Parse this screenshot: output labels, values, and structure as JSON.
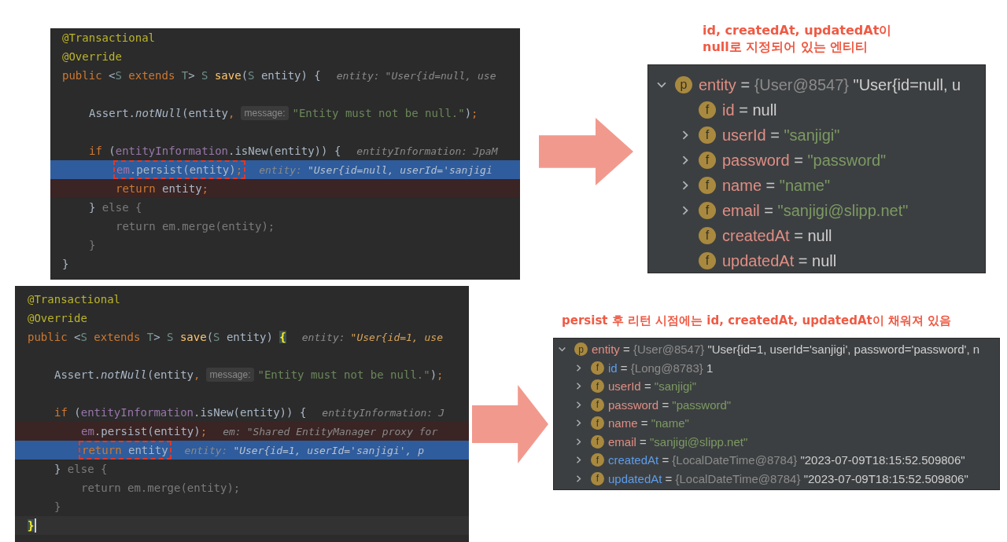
{
  "code_panels": [
    {
      "lines": [
        {
          "kind": "code",
          "segments": [
            {
              "kind": "code",
              "tokens": [
                {
                  "kind": "annotation",
                  "text": "@Transactional"
                }
              ]
            }
          ]
        },
        {
          "kind": "code",
          "segments": [
            {
              "kind": "code",
              "tokens": [
                {
                  "kind": "annotation",
                  "text": "@Override"
                }
              ]
            }
          ]
        },
        {
          "kind": "code",
          "segments": [
            {
              "kind": "code",
              "tokens": [
                {
                  "kind": "keyword",
                  "text": "public"
                },
                {
                  "kind": "plain",
                  "text": " <"
                },
                {
                  "kind": "type",
                  "text": "S"
                },
                {
                  "kind": "keyword",
                  "text": " extends "
                },
                {
                  "kind": "type",
                  "text": "T"
                },
                {
                  "kind": "plain",
                  "text": "> "
                },
                {
                  "kind": "type",
                  "text": "S"
                },
                {
                  "kind": "method",
                  "text": " save"
                },
                {
                  "kind": "plain",
                  "text": "("
                },
                {
                  "kind": "type",
                  "text": "S"
                },
                {
                  "kind": "plain",
                  "text": " entity) {"
                }
              ]
            },
            {
              "kind": "debug_hint",
              "label": "entity:",
              "value": "\"User{id=null, use",
              "changed": false
            }
          ],
          "children": [
            {
              "kind": "blank"
            },
            {
              "kind": "code",
              "segments": [
                {
                  "kind": "code",
                  "tokens": [
                    {
                      "kind": "plain",
                      "text": "Assert."
                    },
                    {
                      "kind": "italic",
                      "text": "notNull"
                    },
                    {
                      "kind": "plain",
                      "text": "(entity"
                    },
                    {
                      "kind": "keyword",
                      "text": ","
                    }
                  ]
                },
                {
                  "kind": "param_hint",
                  "text": "message:"
                },
                {
                  "kind": "code",
                  "tokens": [
                    {
                      "kind": "string",
                      "text": "\"Entity must not be null.\""
                    },
                    {
                      "kind": "plain",
                      "text": ")"
                    },
                    {
                      "kind": "keyword",
                      "text": ";"
                    }
                  ]
                }
              ]
            },
            {
              "kind": "blank"
            },
            {
              "kind": "code",
              "segments": [
                {
                  "kind": "code",
                  "tokens": [
                    {
                      "kind": "keyword",
                      "text": "if"
                    },
                    {
                      "kind": "plain",
                      "text": " ("
                    },
                    {
                      "kind": "field",
                      "text": "entityInformation"
                    },
                    {
                      "kind": "plain",
                      "text": ".isNew(entity)) {"
                    }
                  ]
                },
                {
                  "kind": "debug_hint",
                  "label": "entityInformation:",
                  "value": "JpaM",
                  "changed": false
                }
              ],
              "children": [
                {
                  "kind": "current",
                  "segments": [
                    {
                      "kind": "code",
                      "boxed": true,
                      "tokens": [
                        {
                          "kind": "field",
                          "text": "em"
                        },
                        {
                          "kind": "plain",
                          "text": ".persist(entity)"
                        },
                        {
                          "kind": "keyword",
                          "text": ";"
                        }
                      ]
                    },
                    {
                      "kind": "debug_hint",
                      "label": "entity:",
                      "value": "\"User{id=null, userId='sanjigi",
                      "changed": false
                    }
                  ]
                },
                {
                  "kind": "breakpoint",
                  "segments": [
                    {
                      "kind": "code",
                      "boxed": false,
                      "tokens": [
                        {
                          "kind": "keyword",
                          "text": "return"
                        },
                        {
                          "kind": "plain",
                          "text": " entity"
                        },
                        {
                          "kind": "keyword",
                          "text": ";"
                        }
                      ]
                    }
                  ]
                }
              ]
            },
            {
              "kind": "code",
              "segments": [
                {
                  "kind": "code",
                  "tokens": [
                    {
                      "kind": "plain",
                      "text": "}"
                    },
                    {
                      "kind": "dim",
                      "text": " else {"
                    }
                  ]
                }
              ],
              "children": [
                {
                  "kind": "code",
                  "segments": [
                    {
                      "kind": "code",
                      "tokens": [
                        {
                          "kind": "dim",
                          "text": "return em.merge(entity);"
                        }
                      ]
                    }
                  ]
                }
              ]
            },
            {
              "kind": "code",
              "segments": [
                {
                  "kind": "code",
                  "tokens": [
                    {
                      "kind": "dim",
                      "text": "}"
                    }
                  ]
                }
              ]
            }
          ]
        },
        {
          "kind": "code",
          "segments": [
            {
              "kind": "code",
              "tokens": [
                {
                  "kind": "plain",
                  "text": "}"
                }
              ]
            }
          ]
        }
      ]
    },
    {
      "lines": [
        {
          "kind": "code",
          "segments": [
            {
              "kind": "code",
              "tokens": [
                {
                  "kind": "annotation",
                  "text": "@Transactional"
                }
              ]
            }
          ]
        },
        {
          "kind": "code",
          "segments": [
            {
              "kind": "code",
              "tokens": [
                {
                  "kind": "annotation",
                  "text": "@Override"
                }
              ]
            }
          ]
        },
        {
          "kind": "code",
          "segments": [
            {
              "kind": "code",
              "tokens": [
                {
                  "kind": "keyword",
                  "text": "public"
                },
                {
                  "kind": "plain",
                  "text": " <"
                },
                {
                  "kind": "type",
                  "text": "S"
                },
                {
                  "kind": "keyword",
                  "text": " extends "
                },
                {
                  "kind": "type",
                  "text": "T"
                },
                {
                  "kind": "plain",
                  "text": "> "
                },
                {
                  "kind": "type",
                  "text": "S"
                },
                {
                  "kind": "method",
                  "text": " save"
                },
                {
                  "kind": "plain",
                  "text": "("
                },
                {
                  "kind": "type",
                  "text": "S"
                },
                {
                  "kind": "plain",
                  "text": " entity) "
                },
                {
                  "kind": "brace_match",
                  "text": "{"
                }
              ]
            },
            {
              "kind": "debug_hint",
              "label": "entity:",
              "value": "\"User{id=1, use",
              "changed": true
            }
          ],
          "children": [
            {
              "kind": "blank"
            },
            {
              "kind": "code",
              "segments": [
                {
                  "kind": "code",
                  "tokens": [
                    {
                      "kind": "plain",
                      "text": "Assert."
                    },
                    {
                      "kind": "italic",
                      "text": "notNull"
                    },
                    {
                      "kind": "plain",
                      "text": "(entity"
                    },
                    {
                      "kind": "keyword",
                      "text": ","
                    }
                  ]
                },
                {
                  "kind": "param_hint",
                  "text": "message:"
                },
                {
                  "kind": "code",
                  "tokens": [
                    {
                      "kind": "string",
                      "text": "\"Entity must not be null.\""
                    },
                    {
                      "kind": "plain",
                      "text": ")"
                    },
                    {
                      "kind": "keyword",
                      "text": ";"
                    }
                  ]
                }
              ]
            },
            {
              "kind": "blank"
            },
            {
              "kind": "code",
              "segments": [
                {
                  "kind": "code",
                  "tokens": [
                    {
                      "kind": "keyword",
                      "text": "if"
                    },
                    {
                      "kind": "plain",
                      "text": " ("
                    },
                    {
                      "kind": "field",
                      "text": "entityInformation"
                    },
                    {
                      "kind": "plain",
                      "text": ".isNew(entity)) {"
                    }
                  ]
                },
                {
                  "kind": "debug_hint",
                  "label": "entityInformation:",
                  "value": "J",
                  "changed": false
                }
              ],
              "children": [
                {
                  "kind": "breakpoint",
                  "segments": [
                    {
                      "kind": "code",
                      "boxed": false,
                      "tokens": [
                        {
                          "kind": "field",
                          "text": "em"
                        },
                        {
                          "kind": "plain",
                          "text": ".persist(entity)"
                        },
                        {
                          "kind": "keyword",
                          "text": ";"
                        }
                      ]
                    },
                    {
                      "kind": "debug_hint",
                      "label": "em:",
                      "value": "\"Shared EntityManager proxy for",
                      "changed": false
                    }
                  ]
                },
                {
                  "kind": "current",
                  "segments": [
                    {
                      "kind": "code",
                      "boxed": true,
                      "tokens": [
                        {
                          "kind": "keyword",
                          "text": "return"
                        },
                        {
                          "kind": "plain",
                          "text": " entity"
                        }
                      ]
                    },
                    {
                      "kind": "debug_hint",
                      "label": "entity:",
                      "value": "\"User{id=1, userId='sanjigi', p",
                      "changed": false
                    }
                  ]
                }
              ]
            },
            {
              "kind": "code",
              "segments": [
                {
                  "kind": "code",
                  "tokens": [
                    {
                      "kind": "plain",
                      "text": "}"
                    },
                    {
                      "kind": "dim",
                      "text": " else {"
                    }
                  ]
                }
              ],
              "children": [
                {
                  "kind": "code",
                  "segments": [
                    {
                      "kind": "code",
                      "tokens": [
                        {
                          "kind": "dim",
                          "text": "return em.merge(entity);"
                        }
                      ]
                    }
                  ]
                }
              ]
            },
            {
              "kind": "code",
              "segments": [
                {
                  "kind": "code",
                  "tokens": [
                    {
                      "kind": "dim",
                      "text": "}"
                    }
                  ]
                }
              ]
            }
          ]
        },
        {
          "kind": "caret",
          "segments": [
            {
              "kind": "code",
              "tokens": [
                {
                  "kind": "brace_match",
                  "text": "}"
                }
              ]
            },
            {
              "kind": "cursor"
            }
          ]
        }
      ]
    }
  ],
  "captions": [
    "id, createdAt, updatedAt이\nnull로 지정되어 있는 엔티티",
    "persist 후 리턴 시점에는 id, createdAt, updatedAt이 채워져 있음"
  ],
  "debug_panels": [
    {
      "variables": [
        {
          "badge": "p",
          "name": "entity",
          "op": "=",
          "type_ref": "{User@8547}",
          "value": "\"User{id=null, u",
          "kind": "text",
          "changed": false,
          "expanded": true,
          "children": [
            {
              "badge": "f",
              "name": "id",
              "op": "=",
              "value": "null",
              "kind": "text",
              "changed": false
            },
            {
              "badge": "f",
              "name": "userId",
              "op": "=",
              "value": "\"sanjigi\"",
              "kind": "string",
              "changed": false,
              "expanded": false
            },
            {
              "badge": "f",
              "name": "password",
              "op": "=",
              "value": "\"password\"",
              "kind": "string",
              "changed": false,
              "expanded": false
            },
            {
              "badge": "f",
              "name": "name",
              "op": "=",
              "value": "\"name\"",
              "kind": "string",
              "changed": false,
              "expanded": false
            },
            {
              "badge": "f",
              "name": "email",
              "op": "=",
              "value": "\"sanjigi@slipp.net\"",
              "kind": "string",
              "changed": false,
              "expanded": false
            },
            {
              "badge": "f",
              "name": "createdAt",
              "op": "=",
              "value": "null",
              "kind": "text",
              "changed": false
            },
            {
              "badge": "f",
              "name": "updatedAt",
              "op": "=",
              "value": "null",
              "kind": "text",
              "changed": false
            }
          ]
        }
      ]
    },
    {
      "variables": [
        {
          "badge": "p",
          "name": "entity",
          "op": "=",
          "type_ref": "{User@8547}",
          "value": "\"User{id=1, userId='sanjigi', password='password', n",
          "kind": "text",
          "changed": false,
          "expanded": true,
          "children": [
            {
              "badge": "f",
              "name": "id",
              "op": "=",
              "type_ref": "{Long@8783}",
              "value": "1",
              "kind": "text",
              "changed": true,
              "expanded": false
            },
            {
              "badge": "f",
              "name": "userId",
              "op": "=",
              "value": "\"sanjigi\"",
              "kind": "string",
              "changed": false,
              "expanded": false
            },
            {
              "badge": "f",
              "name": "password",
              "op": "=",
              "value": "\"password\"",
              "kind": "string",
              "changed": false,
              "expanded": false
            },
            {
              "badge": "f",
              "name": "name",
              "op": "=",
              "value": "\"name\"",
              "kind": "string",
              "changed": false,
              "expanded": false
            },
            {
              "badge": "f",
              "name": "email",
              "op": "=",
              "value": "\"sanjigi@slipp.net\"",
              "kind": "string",
              "changed": false,
              "expanded": false
            },
            {
              "badge": "f",
              "name": "createdAt",
              "op": "=",
              "type_ref": "{LocalDateTime@8784}",
              "value": "\"2023-07-09T18:15:52.509806\"",
              "kind": "text",
              "changed": true,
              "expanded": false
            },
            {
              "badge": "f",
              "name": "updatedAt",
              "op": "=",
              "type_ref": "{LocalDateTime@8784}",
              "value": "\"2023-07-09T18:15:52.509806\"",
              "kind": "text",
              "changed": true,
              "expanded": false
            }
          ]
        }
      ]
    }
  ]
}
